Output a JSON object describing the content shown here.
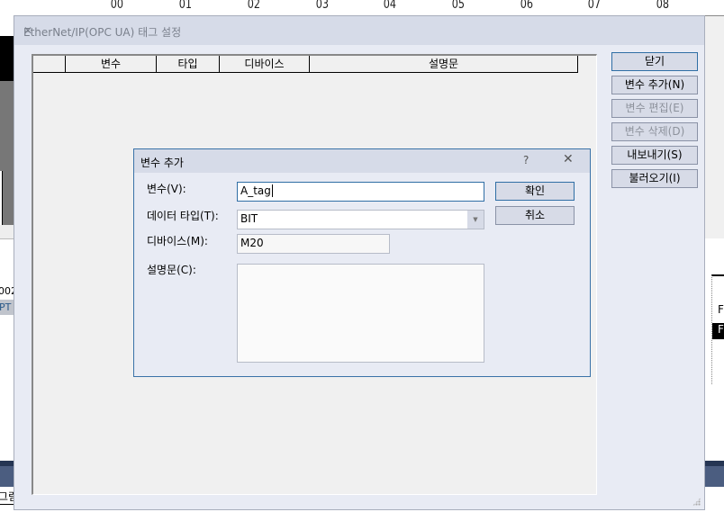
{
  "background": {
    "column_labels": [
      "00",
      "01",
      "02",
      "03",
      "04",
      "05",
      "06",
      "07",
      "08"
    ],
    "left_texts": [
      "002",
      "PT",
      "그림"
    ],
    "right_texts": [
      "F",
      "F"
    ]
  },
  "main_dialog": {
    "title": "EtherNet/IP(OPC UA) 태그 설정",
    "close_glyph": "✕",
    "columns": [
      "",
      "변수",
      "타입",
      "디바이스",
      "설명문"
    ],
    "buttons": [
      {
        "label": "닫기",
        "enabled": true
      },
      {
        "label": "변수 추가(N)",
        "enabled": true
      },
      {
        "label": "변수 편집(E)",
        "enabled": false
      },
      {
        "label": "변수 삭제(D)",
        "enabled": false
      },
      {
        "label": "내보내기(S)",
        "enabled": true
      },
      {
        "label": "불러오기(I)",
        "enabled": true
      }
    ]
  },
  "add_dialog": {
    "title": "변수 추가",
    "help_glyph": "?",
    "close_glyph": "✕",
    "variable_label": "변수(V):",
    "variable_value": "A_tag",
    "type_label": "데이터 타입(T):",
    "type_value": "BIT",
    "device_label": "디바이스(M):",
    "device_value": "M20",
    "desc_label": "설명문(C):",
    "desc_value": "",
    "ok_label": "확인",
    "cancel_label": "취소"
  }
}
